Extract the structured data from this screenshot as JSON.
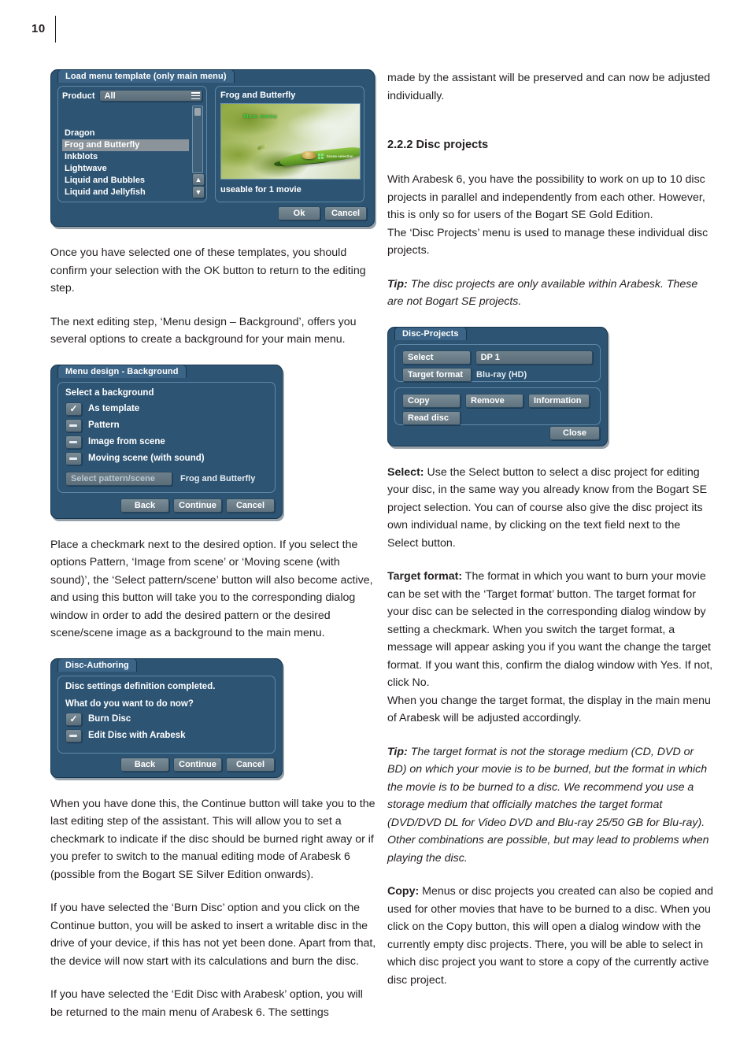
{
  "page": {
    "number": "10"
  },
  "left_column": {
    "para1": "Once you have selected one of these templates, you should confirm your selection with the OK button to return to the editing step.",
    "para2": "The next editing step, ‘Menu design – Background’, offers you several options to create a background for your main menu.",
    "para3": "Place a checkmark next to the desired option.  If you select the options Pattern, ‘Image from scene’ or ‘Moving scene (with sound)’, the ‘Select pattern/scene’ button will also become active, and using this button will take you to the corresponding dialog window in order to add the desired pattern or the desired scene/scene image as a background to the main menu.",
    "para4": "When you have done this, the Continue button will take you to the last editing step of the assistant. This will allow you to set a checkmark to indicate if the disc should be burned right away or if you prefer to switch to the manual editing mode of Arabesk 6 (possible from the Bogart SE Silver Edition onwards).",
    "para5": "If you have selected the ‘Burn Disc’ option and you click on the Continue button, you will be asked to insert a writable disc in the drive of your device, if this has not yet been done. Apart from that, the device will now start with its calculations and burn the disc.",
    "para6": "If you have selected the ‘Edit Disc with Arabesk’ option, you will be returned to the main menu of Arabesk 6. The settings"
  },
  "right_column": {
    "para1": "made by the assistant will be preserved and can now be adjusted individually.",
    "heading": "2.2.2 Disc projects",
    "para2": "With Arabesk 6, you have the possibility to work on up to 10 disc projects in parallel and independently from each other. However, this is only so for users of the Bogart SE Gold Edition.",
    "para3": "The ‘Disc Projects’ menu is used to manage these individual disc projects.",
    "tip1_label": "Tip:",
    "tip1_text": " The disc projects are only available within Arabesk. These are not Bogart SE projects.",
    "select_label": "Select:",
    "select_text": " Use the Select button to select a disc project for editing your disc, in the same way you already know from the Bogart SE project selection. You can of course also give the disc project its own individual name, by clicking on the text field next to the Select button.",
    "target_label": "Target format:",
    "target_text": " The format in which you want to burn your movie can be set with the ‘Target format’ button. The target format for your disc can be selected in the corresponding dialog window by setting a checkmark. When you switch the target format, a message will appear asking you if you want the change the target format. If you want this, confirm the dialog window with Yes. If not, click No.",
    "target_text2": "When you change the target format, the display in the main menu of Arabesk will be adjusted accordingly.",
    "tip2_label": "Tip:",
    "tip2_text": " The target format is not the storage medium (CD, DVD or BD) on which your movie is to be burned, but the format in which the movie is to be burned to a disc. We recommend you use a storage medium that officially matches the target format (DVD/DVD DL for Video DVD and Blu-ray 25/50 GB for Blu-ray). Other combinations are possible, but may lead to problems when playing the disc.",
    "copy_label": "Copy:",
    "copy_text": " Menus or disc projects you created can also be copied and used for other movies that have to be burned to a disc. When you click on the Copy button, this will open a dialog window with the currently empty disc projects. There, you will be able to select in which disc project you want to store a copy of the currently active disc project."
  },
  "dialog_load_template": {
    "title": "Load menu template (only main menu)",
    "product_label": "Product",
    "product_value": "All",
    "menu_icon": "hamburger-icon",
    "list_items": [
      "Dragon",
      "Frog and Butterfly",
      "Inkblots",
      "Lightwave",
      "Liquid and Bubbles",
      "Liquid and Jellyfish"
    ],
    "selected_item": "Frog and Butterfly",
    "scroll_up_icon": "chevron-up-icon",
    "scroll_down_icon": "chevron-down-icon",
    "preview_title": "Frog and Butterfly",
    "preview_main_text": "Main menu",
    "preview_sub_text": "Scene selection",
    "useable_text": "useable for 1 movie",
    "ok_label": "Ok",
    "cancel_label": "Cancel"
  },
  "dialog_menu_design": {
    "title": "Menu design - Background",
    "heading": "Select a background",
    "options": [
      {
        "label": "As template",
        "checked": true
      },
      {
        "label": "Pattern",
        "checked": false
      },
      {
        "label": "Image from scene",
        "checked": false
      },
      {
        "label": "Moving scene (with sound)",
        "checked": false
      }
    ],
    "select_pattern_label": "Select pattern/scene",
    "selected_pattern_value": "Frog and Butterfly",
    "back_label": "Back",
    "continue_label": "Continue",
    "cancel_label": "Cancel"
  },
  "dialog_disc_authoring": {
    "title": "Disc-Authoring",
    "message": "Disc settings definition completed.",
    "question": "What do you want to do now?",
    "options": [
      {
        "label": "Burn Disc",
        "checked": true
      },
      {
        "label": "Edit Disc with Arabesk",
        "checked": false
      }
    ],
    "back_label": "Back",
    "continue_label": "Continue",
    "cancel_label": "Cancel"
  },
  "dialog_disc_projects": {
    "title": "Disc-Projects",
    "select_label": "Select",
    "project_name": "DP 1",
    "target_format_label": "Target format",
    "target_format_value": "Blu-ray (HD)",
    "copy_label": "Copy",
    "remove_label": "Remove",
    "information_label": "Information",
    "read_disc_label": "Read disc",
    "close_label": "Close"
  },
  "colors": {
    "dialog_bg": "#2d5473",
    "dialog_title_bg": "#3b6486",
    "panel_border": "#5e87a6",
    "button_face": "#6d7f8a",
    "selected_row": "#8b949b",
    "text": "#231f20"
  }
}
